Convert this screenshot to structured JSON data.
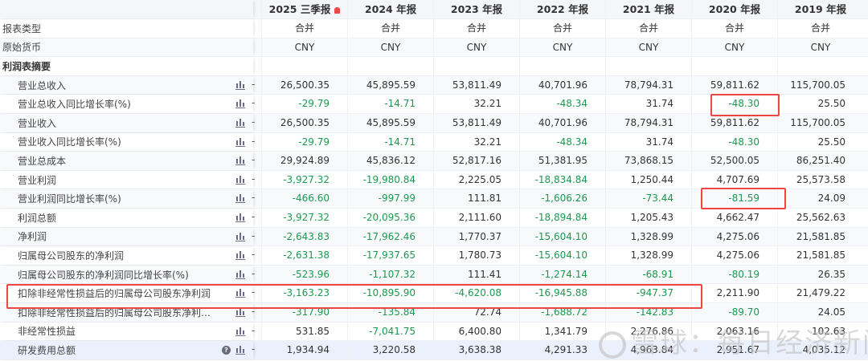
{
  "columns": [
    "2025 三季报",
    "2024 年报",
    "2023 年报",
    "2022 年报",
    "2021 年报",
    "2020 年报",
    "2019 年报"
  ],
  "meta_rows": [
    {
      "label": "报表类型",
      "values": [
        "合并",
        "合并",
        "合并",
        "合并",
        "合并",
        "合并",
        "合并"
      ]
    },
    {
      "label": "原始货币",
      "values": [
        "CNY",
        "CNY",
        "CNY",
        "CNY",
        "CNY",
        "CNY",
        "CNY"
      ]
    }
  ],
  "section_title": "利润表摘要",
  "rows": [
    {
      "label": "营业总收入",
      "values": [
        "26,500.35",
        "45,895.59",
        "53,811.49",
        "40,701.96",
        "78,794.31",
        "59,811.62",
        "115,700.05"
      ]
    },
    {
      "label": "营业总收入同比增长率(%)",
      "values": [
        "-29.79",
        "-14.71",
        "32.21",
        "-48.34",
        "31.74",
        "-48.30",
        "25.50"
      ]
    },
    {
      "label": "营业收入",
      "values": [
        "26,500.35",
        "45,895.59",
        "53,811.49",
        "40,701.96",
        "78,794.31",
        "59,811.62",
        "115,700.05"
      ]
    },
    {
      "label": "营业收入同比增长率(%)",
      "values": [
        "-29.79",
        "-14.71",
        "32.21",
        "-48.34",
        "31.74",
        "-48.30",
        "25.50"
      ]
    },
    {
      "label": "营业总成本",
      "values": [
        "29,924.89",
        "45,836.12",
        "52,817.16",
        "51,381.95",
        "73,868.15",
        "52,500.05",
        "86,251.40"
      ]
    },
    {
      "label": "营业利润",
      "values": [
        "-3,927.32",
        "-19,980.84",
        "2,225.05",
        "-18,834.84",
        "1,250.44",
        "4,707.69",
        "25,573.58"
      ]
    },
    {
      "label": "营业利润同比增长率(%)",
      "values": [
        "-466.60",
        "-997.99",
        "111.81",
        "-1,606.26",
        "-73.44",
        "-81.59",
        "24.09"
      ]
    },
    {
      "label": "利润总额",
      "values": [
        "-3,927.32",
        "-20,095.36",
        "2,111.60",
        "-18,894.84",
        "1,205.43",
        "4,662.47",
        "25,562.63"
      ]
    },
    {
      "label": "净利润",
      "values": [
        "-2,643.83",
        "-17,962.46",
        "1,770.37",
        "-15,604.10",
        "1,328.99",
        "4,275.06",
        "21,581.85"
      ]
    },
    {
      "label": "归属母公司股东的净利润",
      "values": [
        "-2,631.38",
        "-17,937.65",
        "1,780.73",
        "-15,604.10",
        "1,328.99",
        "4,275.06",
        "21,581.85"
      ]
    },
    {
      "label": "归属母公司股东的净利润同比增长率(%)",
      "values": [
        "-523.96",
        "-1,107.32",
        "111.41",
        "-1,274.14",
        "-68.91",
        "-80.19",
        "26.35"
      ]
    },
    {
      "label": "扣除非经常性损益后的归属母公司股东净利润",
      "values": [
        "-3,163.23",
        "-10,895.90",
        "-4,620.08",
        "-16,945.88",
        "-947.37",
        "2,211.90",
        "21,479.22"
      ]
    },
    {
      "label": "扣除非经常性损益后的归属母公司股东净利润同比增长率(%)",
      "values": [
        "-317.90",
        "-135.84",
        "72.74",
        "-1,688.72",
        "-142.83",
        "-89.70",
        "24.05"
      ]
    },
    {
      "label": "非经常性损益",
      "values": [
        "531.85",
        "-7,041.75",
        "6,400.80",
        "1,341.79",
        "2,276.86",
        "2,063.16",
        "102.63"
      ]
    },
    {
      "label": "研发费用总额",
      "values": [
        "1,934.94",
        "3,220.58",
        "3,638.38",
        "4,291.33",
        "4,963.84",
        "2,951.67",
        "4,035.12"
      ],
      "help": "?"
    }
  ],
  "watermark": "雪球：每日经济新闻",
  "colors": {
    "negative": "#1a9a4f",
    "highlight": "#ef4444",
    "alert": "#f04848"
  }
}
